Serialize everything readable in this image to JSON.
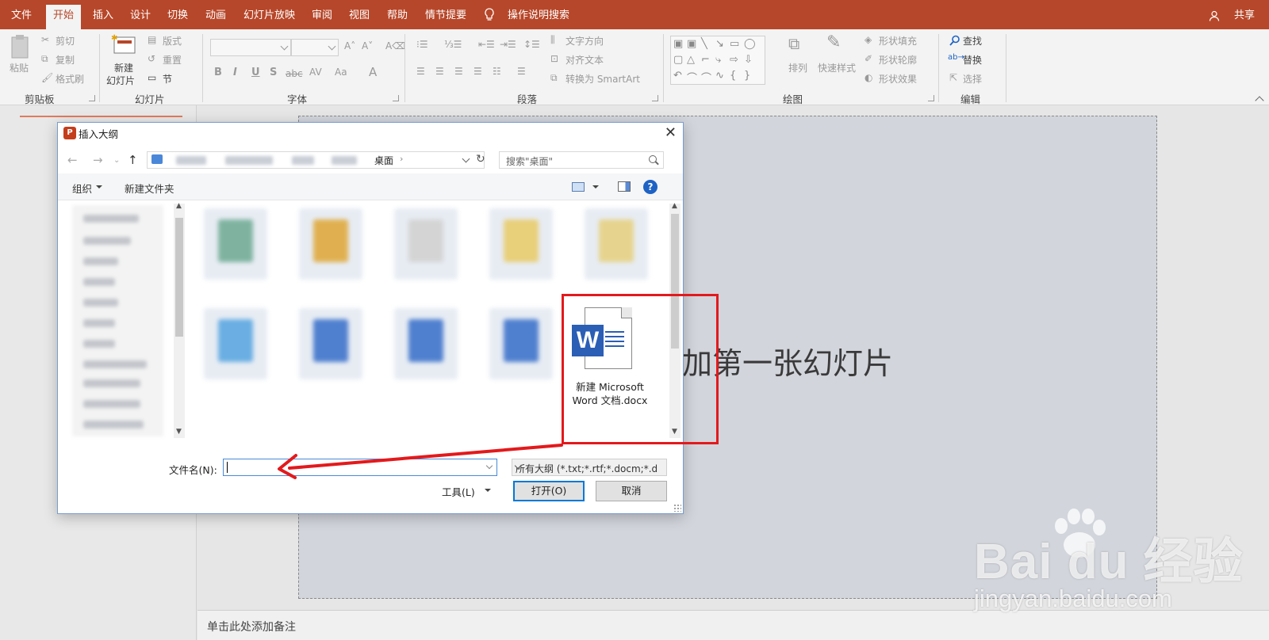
{
  "tabs": [
    {
      "label": "文件"
    },
    {
      "label": "开始"
    },
    {
      "label": "插入"
    },
    {
      "label": "设计"
    },
    {
      "label": "切换"
    },
    {
      "label": "动画"
    },
    {
      "label": "幻灯片放映"
    },
    {
      "label": "审阅"
    },
    {
      "label": "视图"
    },
    {
      "label": "帮助"
    },
    {
      "label": "情节提要"
    }
  ],
  "tell_me": "操作说明搜索",
  "share": "共享",
  "ribbon": {
    "clipboard": {
      "paste": "粘贴",
      "cut": "剪切",
      "copy": "复制",
      "format_painter": "格式刷",
      "label": "剪贴板"
    },
    "slides": {
      "new_slide_1": "新建",
      "new_slide_2": "幻灯片",
      "layout": "版式",
      "reset": "重置",
      "section": "节",
      "label": "幻灯片"
    },
    "font": {
      "label": "字体"
    },
    "paragraph": {
      "text_direction": "文字方向",
      "align_text": "对齐文本",
      "smartart": "转换为 SmartArt",
      "label": "段落"
    },
    "drawing": {
      "arrange": "排列",
      "quick_styles": "快速样式",
      "shape_fill": "形状填充",
      "shape_outline": "形状轮廓",
      "shape_effects": "形状效果",
      "label": "绘图"
    },
    "editing": {
      "find": "查找",
      "replace": "替换",
      "select": "选择",
      "label": "编辑"
    }
  },
  "slide": {
    "placeholder": "加第一张幻灯片"
  },
  "notes": {
    "placeholder": "单击此处添加备注"
  },
  "dialog": {
    "title": "插入大纲",
    "breadcrumb_current": "桌面",
    "search_placeholder": "搜索\"桌面\"",
    "organize": "组织",
    "new_folder": "新建文件夹",
    "file": {
      "name_line1": "新建 Microsoft",
      "name_line2": "Word 文档.docx"
    },
    "filename_label": "文件名(N):",
    "filename_value": "",
    "filter": "所有大纲 (*.txt;*.rtf;*.docm;*.d",
    "tools": "工具(L)",
    "open": "打开(O)",
    "cancel": "取消"
  },
  "watermark": {
    "brand": "Bai du 经验",
    "url": "jingyan.baidu.com"
  },
  "colors": {
    "accent": "#b7472a",
    "annotation": "#e3191c",
    "word_blue": "#2b5eb5"
  }
}
